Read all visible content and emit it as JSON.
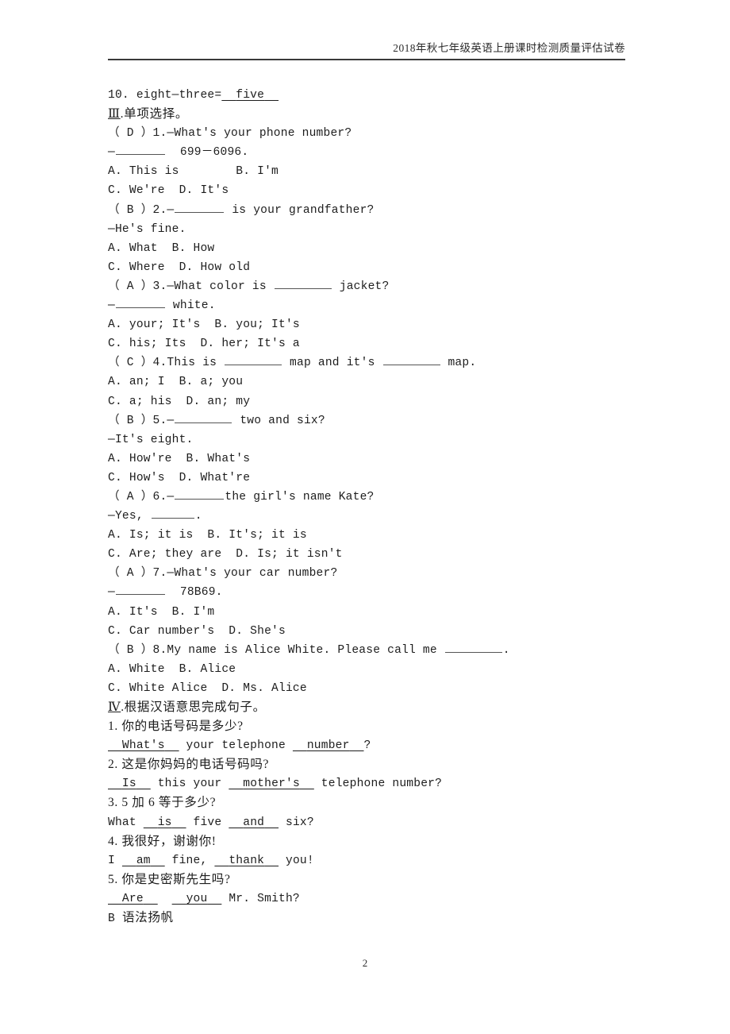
{
  "header": {
    "title": "2018年秋七年级英语上册课时检测质量评估试卷"
  },
  "footer": {
    "page_number": "2"
  },
  "content": {
    "carryover_item": {
      "number": "10.",
      "text": "eight—three=",
      "answer": "five"
    },
    "section_3": {
      "numeral": "Ⅲ",
      "title": ".单项选择。",
      "questions": [
        {
          "answer": "D",
          "number": "1.",
          "stem": "—What's your phone number?",
          "stem2_pre": "—",
          "stem2_post": "  699－6096.",
          "options_line1": "A. This is        B. I'm",
          "options_line2": "C. We're  D. It's"
        },
        {
          "answer": "B",
          "number": "2.",
          "stem_pre": "—",
          "stem_post": " is your grandfather?",
          "stem2": "—He's fine.",
          "options_line1": "A. What  B. How",
          "options_line2": "C. Where  D. How old"
        },
        {
          "answer": "A",
          "number": "3.",
          "stem_pre": "—What color is ",
          "stem_post": " jacket?",
          "stem2_pre": "—",
          "stem2_post": " white.",
          "options_line1": "A. your; It's  B. you; It's",
          "options_line2": "C. his; Its  D. her; It's a"
        },
        {
          "answer": "C",
          "number": "4.",
          "stem_pre": "This is ",
          "stem_mid": " map and it's ",
          "stem_post": " map.",
          "options_line1": "A. an; I  B. a; you",
          "options_line2": "C. a; his  D. an; my"
        },
        {
          "answer": "B",
          "number": "5.",
          "stem_pre": "—",
          "stem_post": " two and six?",
          "stem2": "—It's eight.",
          "options_line1": "A. How're  B. What's",
          "options_line2": "C. How's  D. What're"
        },
        {
          "answer": "A",
          "number": "6.",
          "stem_pre": "—",
          "stem_post": "the girl's name Kate?",
          "stem2_pre": "—Yes, ",
          "stem2_post": ".",
          "options_line1": "A. Is; it is  B. It's; it is",
          "options_line2": "C. Are; they are  D. Is; it isn't"
        },
        {
          "answer": "A",
          "number": "7.",
          "stem": "—What's your car number?",
          "stem2_pre": "—",
          "stem2_post": "  78B69.",
          "options_line1": "A. It's  B. I'm",
          "options_line2": "C. Car number's  D. She's"
        },
        {
          "answer": "B",
          "number": "8.",
          "stem_pre": "My name is Alice White. Please call me ",
          "stem_post": ".",
          "options_line1": "A. White  B. Alice",
          "options_line2": "C. White Alice  D. Ms. Alice"
        }
      ]
    },
    "section_4": {
      "numeral": "Ⅳ",
      "title": ".根据汉语意思完成句子。",
      "items": [
        {
          "number": "1.",
          "chinese": " 你的电话号码是多少?",
          "parts": [
            "",
            "What's",
            " your telephone ",
            "number",
            "?"
          ]
        },
        {
          "number": "2.",
          "chinese": " 这是你妈妈的电话号码吗?",
          "parts": [
            "",
            "Is",
            " this your ",
            "mother's",
            " telephone number?"
          ]
        },
        {
          "number": "3.",
          "chinese": " 5 加 6 等于多少?",
          "parts": [
            "What ",
            "is",
            " five ",
            "and",
            " six?"
          ]
        },
        {
          "number": "4.",
          "chinese": " 我很好，谢谢你!",
          "parts": [
            "I ",
            "am",
            " fine, ",
            "thank",
            " you!"
          ]
        },
        {
          "number": "5.",
          "chinese": " 你是史密斯先生吗?",
          "parts": [
            "",
            "Are",
            "  ",
            "you",
            " Mr. Smith?"
          ]
        }
      ]
    },
    "tail": {
      "label": "B",
      "text": "  语法扬帆"
    }
  }
}
